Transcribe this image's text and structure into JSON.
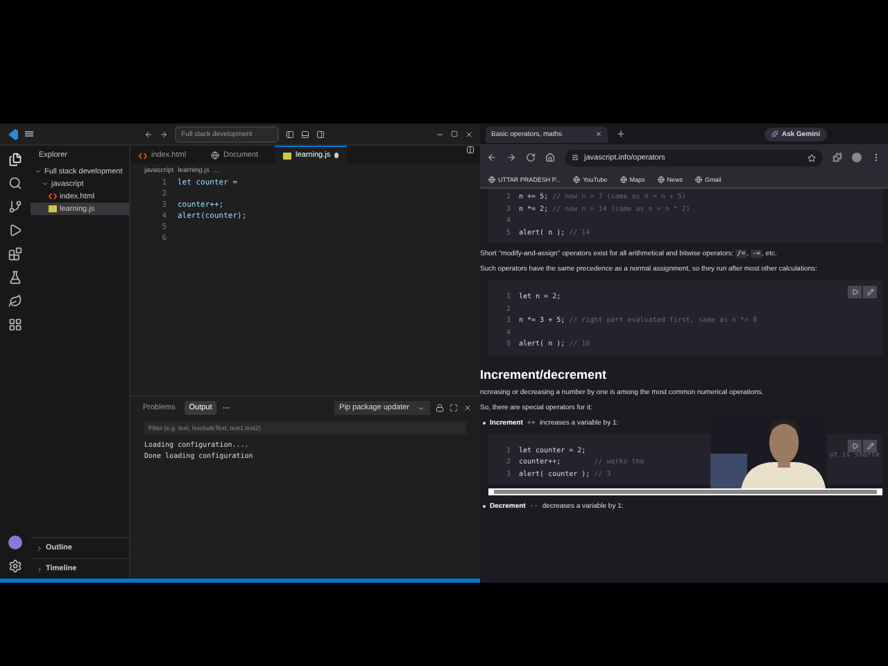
{
  "vscode": {
    "search": "Full stack development",
    "explorer": {
      "title": "Explorer",
      "tree": [
        {
          "label": "Full stack development",
          "expanded": true,
          "children": [
            {
              "label": "javascript",
              "expanded": true,
              "children": [
                {
                  "label": "index.html",
                  "kind": "html",
                  "selected": false
                },
                {
                  "label": "learning.js",
                  "kind": "js",
                  "selected": true
                }
              ]
            }
          ]
        }
      ]
    },
    "tabs": [
      {
        "label": "index.html",
        "kind": "html",
        "selected": false,
        "modified": false
      },
      {
        "label": "Document",
        "kind": "globe",
        "selected": false,
        "modified": false
      },
      {
        "label": "learning.js",
        "kind": "js",
        "selected": true,
        "modified": true
      }
    ],
    "breadcrumb": [
      "javascript",
      "learning.js",
      "..."
    ],
    "code": [
      {
        "n": "1",
        "code": "let counter ="
      },
      {
        "n": "2"
      },
      {
        "n": "3",
        "code": "counter++;"
      },
      {
        "n": "4",
        "code": "alert(counter);"
      },
      {
        "n": "5"
      },
      {
        "n": "6"
      }
    ],
    "panel": {
      "tabs": [
        {
          "label": "Problems",
          "selected": false
        },
        {
          "label": "Output",
          "selected": true
        }
      ],
      "channel": "Pip package updater",
      "filter_placeholder": "Filter (e.g. text, !excludeText, text1,text2)",
      "lines": [
        "Loading configuration....",
        "Done loading configuration"
      ]
    },
    "sections": [
      {
        "label": "Outline",
        "expanded": false
      },
      {
        "label": "Timeline",
        "expanded": false
      }
    ]
  },
  "browser": {
    "tab": "Basic operators, maths",
    "gemini": "Ask Gemini",
    "url": "javascript.info/operators",
    "bookmarks": [
      "UTTAR PRADESH P...",
      "YouTube",
      "Maps",
      "News",
      "Gmail"
    ],
    "blocks": [
      {
        "kind": "code",
        "buttons": false,
        "lines": [
          {
            "n": "2",
            "code": "n += 5; ",
            "comment": "// now n = 7 (same as n = n + 5)"
          },
          {
            "n": "3",
            "code": "n *= 2; ",
            "comment": "// now n = 14 (same as n = n * 2)"
          },
          {
            "n": "4"
          },
          {
            "n": "5",
            "code": "alert( n ); ",
            "comment": "// 14"
          }
        ]
      },
      {
        "kind": "para",
        "parts": [
          {
            "t": "Short \"modify-and-assign\" operators exist for all arithmetical and bitwise operators: ",
            "code": false
          },
          {
            "t": "/=",
            "code": true
          },
          {
            "t": ", ",
            "code": false
          },
          {
            "t": "-=",
            "code": true
          },
          {
            "t": ", etc.",
            "code": false
          }
        ]
      },
      {
        "kind": "para",
        "parts": [
          {
            "t": "Such operators have the same precedence as a normal assignment, so they run after most other calculations:",
            "code": false
          }
        ]
      },
      {
        "kind": "code",
        "buttons": true,
        "lines": [
          {
            "n": "1",
            "code": "let n = 2;"
          },
          {
            "n": "2"
          },
          {
            "n": "3",
            "code": "n *= 3 + 5; ",
            "comment": "// right part evaluated first, same as n *= 8"
          },
          {
            "n": "4"
          },
          {
            "n": "5",
            "code": "alert( n ); ",
            "comment": "// 16"
          }
        ]
      },
      {
        "kind": "heading",
        "text": "Increment/decrement"
      },
      {
        "kind": "para",
        "parts": [
          {
            "t": "ncreasing or decreasing a number by one is among the most common numerical operations.",
            "code": false
          }
        ]
      },
      {
        "kind": "para",
        "parts": [
          {
            "t": "So, there are special operators for it:",
            "code": false
          }
        ]
      },
      {
        "kind": "bullet",
        "term": "Increment",
        "op": "++",
        "text": "increases a variable by 1:"
      },
      {
        "kind": "code",
        "buttons": true,
        "scroll": true,
        "webcam": true,
        "lines": [
          {
            "n": "1",
            "code": "let counter = 2;"
          },
          {
            "n": "2",
            "code": "counter++;        ",
            "comment": "// works the",
            "tail": "ut is shorte"
          },
          {
            "n": "3",
            "code": "alert( counter ); ",
            "comment": "// 3"
          }
        ]
      },
      {
        "kind": "bullet",
        "term": "Decrement",
        "op": "--",
        "text": "decreases a variable by 1:"
      }
    ]
  }
}
